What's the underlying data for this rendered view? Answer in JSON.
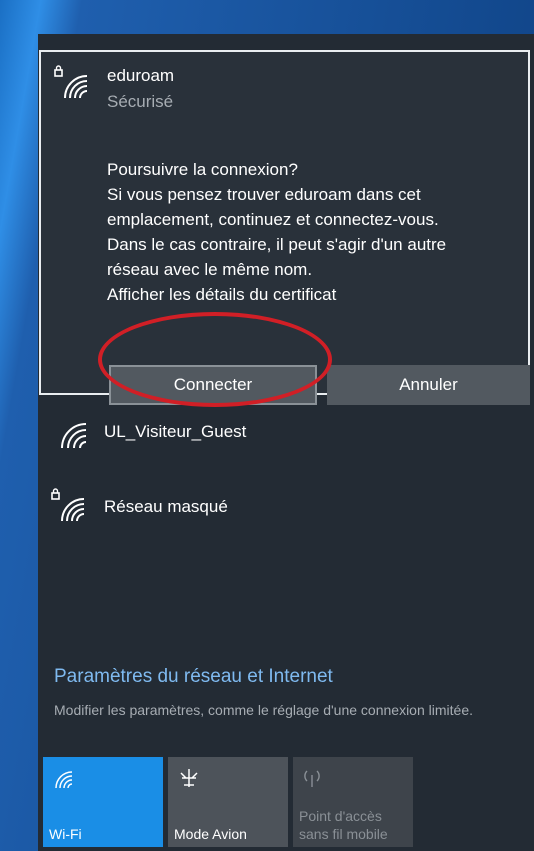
{
  "selected_network": {
    "name": "eduroam",
    "status": "Sécurisé",
    "icon": "wifi-secured-icon",
    "message_lines": [
      "Poursuivre la connexion?",
      "Si vous pensez trouver eduroam dans cet",
      "emplacement, continuez et connectez-vous.",
      "Dans le cas contraire, il peut s'agir d'un autre",
      "réseau avec le même nom.",
      "Afficher les détails du certificat"
    ],
    "connect_label": "Connecter",
    "cancel_label": "Annuler"
  },
  "networks": [
    {
      "name": "UL_Visiteur_Guest",
      "icon": "wifi-icon"
    },
    {
      "name": "Réseau masqué",
      "icon": "wifi-secured-icon"
    }
  ],
  "settings": {
    "title": "Paramètres du réseau et Internet",
    "description": "Modifier les paramètres, comme le réglage d'une connexion limitée."
  },
  "quick_actions": [
    {
      "label": "Wi-Fi",
      "icon": "wifi-icon",
      "active": true
    },
    {
      "label": "Mode Avion",
      "icon": "airplane-icon",
      "active": false
    },
    {
      "label": "Point d'accès sans fil mobile",
      "icon": "hotspot-icon",
      "active": false,
      "disabled": true
    }
  ],
  "colors": {
    "accent": "#1a8ee6",
    "link": "#7fbaf0",
    "highlight_circle": "#d11f26",
    "flyout_bg": "#232b34"
  }
}
